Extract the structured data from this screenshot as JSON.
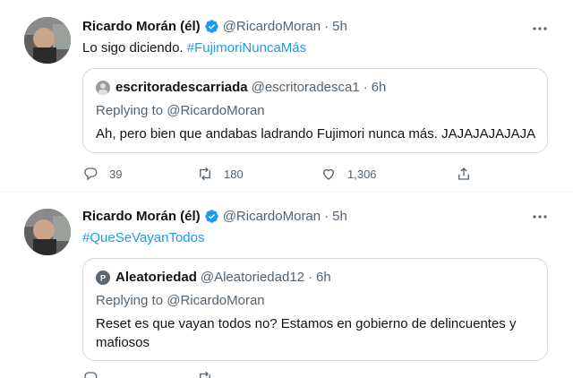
{
  "tweets": [
    {
      "author_name": "Ricardo Morán (él)",
      "author_handle": "@RicardoMoran",
      "separator": "·",
      "time": "5h",
      "text_plain": "Lo sigo diciendo. ",
      "text_hashtag": "#FujimoriNuncaMás",
      "quote": {
        "name": "escritoradescarriada",
        "handle": "@escritoradesca1",
        "separator": "·",
        "time": "6h",
        "replying": "Replying to @RicardoMoran",
        "body": "Ah, pero bien que andabas ladrando Fujimori nunca más. JAJAJAJAJAJA"
      },
      "actions": {
        "replies": "39",
        "retweets": "180",
        "likes": "1,306"
      }
    },
    {
      "author_name": "Ricardo Morán (él)",
      "author_handle": "@RicardoMoran",
      "separator": "·",
      "time": "5h",
      "text_plain": "",
      "text_hashtag": "#QueSeVayanTodos",
      "quote": {
        "name": "Aleatoriedad",
        "handle": "@Aleatoriedad12",
        "separator": "·",
        "time": "6h",
        "replying": "Replying to @RicardoMoran",
        "body": "Reset es que vayan todos no? Estamos en gobierno de delincuentes y mafiosos"
      },
      "actions": {
        "replies": "",
        "retweets": "",
        "likes": ""
      }
    }
  ],
  "icons": {
    "verified": "verified-badge-icon",
    "more": "more-options-icon",
    "reply": "reply-icon",
    "retweet": "retweet-icon",
    "like": "like-icon",
    "share": "share-icon"
  },
  "colors": {
    "accent": "#1d9bf0",
    "secondary_text": "#536471",
    "border": "#cfd9de"
  }
}
